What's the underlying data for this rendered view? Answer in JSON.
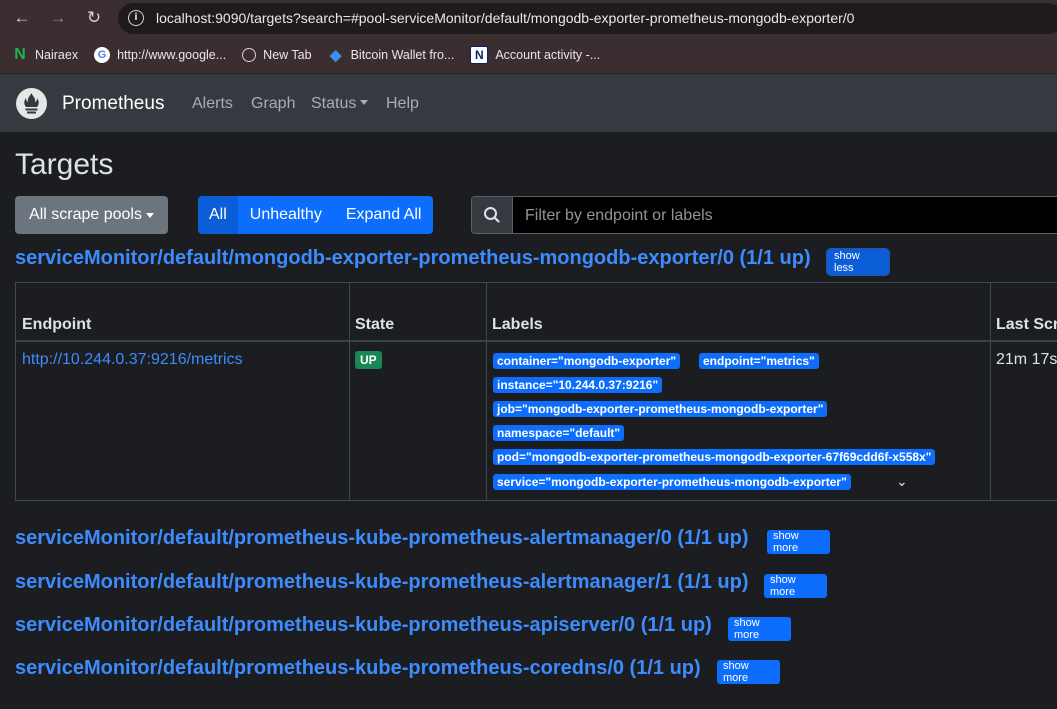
{
  "browser": {
    "url": "localhost:9090/targets?search=#pool-serviceMonitor/default/mongodb-exporter-prometheus-mongodb-exporter/0",
    "bookmarks": [
      {
        "label": "Nairaex",
        "icon": "naira-n-icon"
      },
      {
        "label": "http://www.google...",
        "icon": "google-icon"
      },
      {
        "label": "New Tab",
        "icon": "globe-icon"
      },
      {
        "label": "Bitcoin Wallet fro...",
        "icon": "bitcoin-wallet-icon"
      },
      {
        "label": "Account activity -...",
        "icon": "n-logo-icon"
      }
    ]
  },
  "navbar": {
    "brand": "Prometheus",
    "links": [
      "Alerts",
      "Graph",
      "Status",
      "Help"
    ]
  },
  "page": {
    "title": "Targets",
    "pool_select": "All scrape pools",
    "filters": [
      "All",
      "Unhealthy",
      "Expand All"
    ],
    "search_placeholder": "Filter by endpoint or labels"
  },
  "pools": [
    {
      "name": "serviceMonitor/default/mongodb-exporter-prometheus-mongodb-exporter/0 (1/1 up)",
      "toggle": "show less"
    },
    {
      "name": "serviceMonitor/default/prometheus-kube-prometheus-alertmanager/0 (1/1 up)",
      "toggle": "show more"
    },
    {
      "name": "serviceMonitor/default/prometheus-kube-prometheus-alertmanager/1 (1/1 up)",
      "toggle": "show more"
    },
    {
      "name": "serviceMonitor/default/prometheus-kube-prometheus-apiserver/0 (1/1 up)",
      "toggle": "show more"
    },
    {
      "name": "serviceMonitor/default/prometheus-kube-prometheus-coredns/0 (1/1 up)",
      "toggle": "show more"
    }
  ],
  "table": {
    "headers": [
      "Endpoint",
      "State",
      "Labels",
      "Last Scr"
    ],
    "row": {
      "endpoint": "http://10.244.0.37:9216/metrics",
      "state": "UP",
      "labels": [
        "container=\"mongodb-exporter\"",
        "endpoint=\"metrics\"",
        "instance=\"10.244.0.37:9216\"",
        "job=\"mongodb-exporter-prometheus-mongodb-exporter\"",
        "namespace=\"default\"",
        "pod=\"mongodb-exporter-prometheus-mongodb-exporter-67f69cdd6f-x558x\"",
        "service=\"mongodb-exporter-prometheus-mongodb-exporter\""
      ],
      "last_scrape": "21m 17s"
    }
  },
  "colors": {
    "link_blue": "#3d8bfd",
    "primary": "#0d6efd",
    "up_green": "#198754",
    "navbar": "#343a40",
    "background": "#1b1d20"
  }
}
